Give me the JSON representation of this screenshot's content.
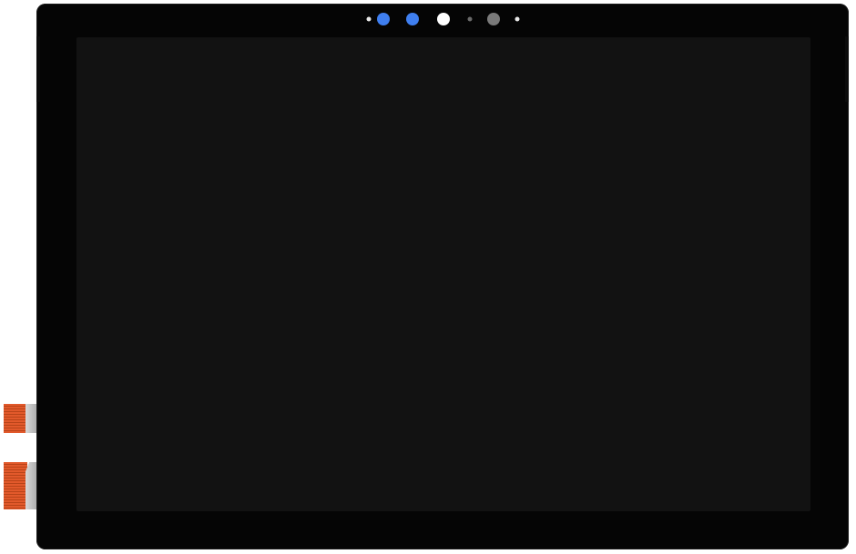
{
  "device": {
    "panel_color": "#050505",
    "screen_color": "#121212",
    "screen_state": "off"
  },
  "sensors": [
    {
      "name": "ir-emitter-left",
      "color": "#e8e8e8"
    },
    {
      "name": "ir-camera-left",
      "color": "#3f7ff0"
    },
    {
      "name": "ir-camera-right",
      "color": "#3f7ff0"
    },
    {
      "name": "front-camera",
      "color": "#ffffff"
    },
    {
      "name": "ambient-light-sensor",
      "color": "#6a6a6a"
    },
    {
      "name": "camera-lens",
      "color": "#7a7a7a"
    },
    {
      "name": "ir-emitter-right",
      "color": "#e8e8e8"
    }
  ],
  "flex_cables": [
    {
      "name": "display-flex-cable",
      "color": "#e2592b"
    },
    {
      "name": "digitizer-flex-cable",
      "color": "#e2592b"
    }
  ]
}
